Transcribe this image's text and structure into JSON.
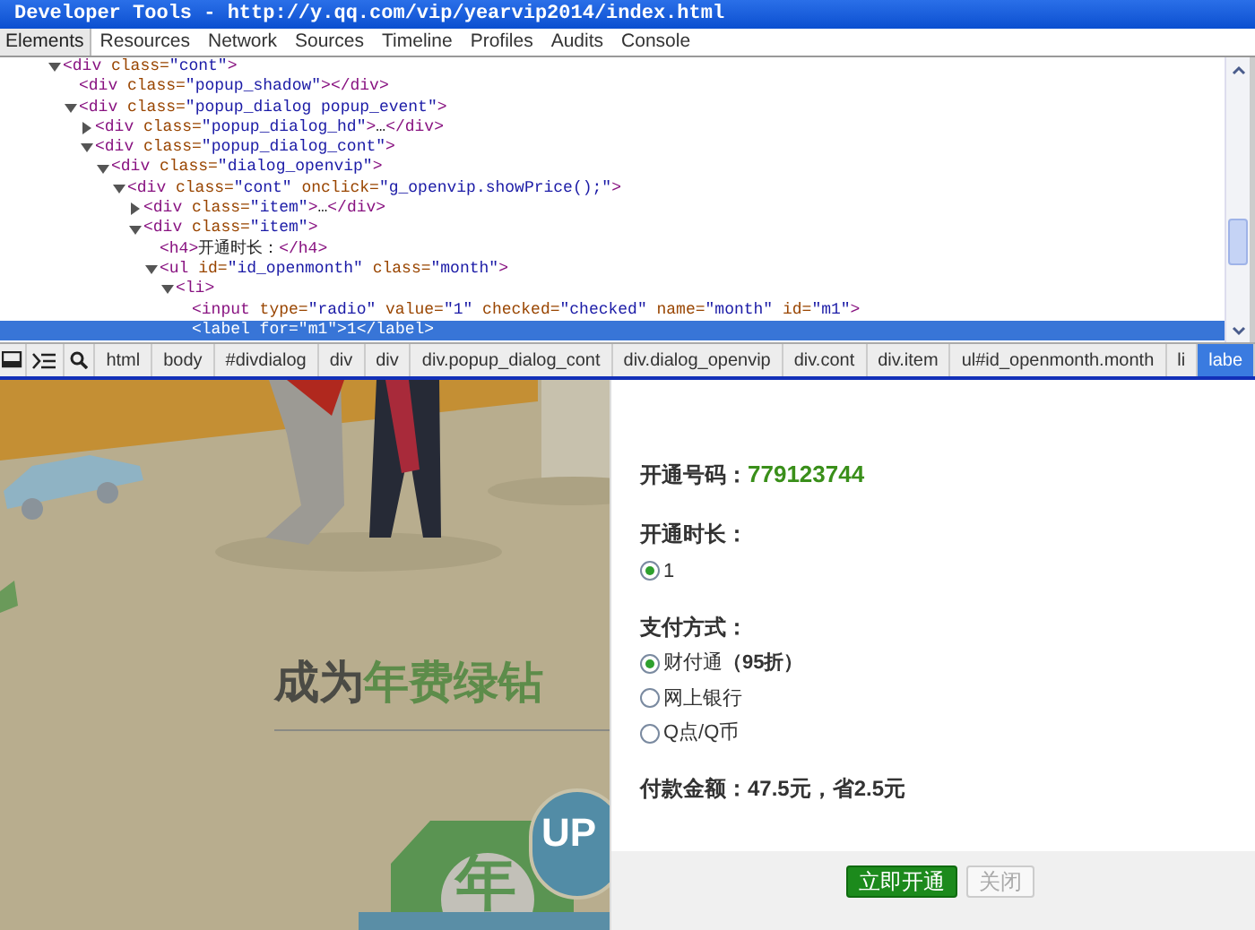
{
  "window": {
    "title": "Developer Tools - http://y.qq.com/vip/yearvip2014/index.html"
  },
  "tabs": [
    {
      "label": "Elements",
      "selected": true
    },
    {
      "label": "Resources",
      "selected": false
    },
    {
      "label": "Network",
      "selected": false
    },
    {
      "label": "Sources",
      "selected": false
    },
    {
      "label": "Timeline",
      "selected": false
    },
    {
      "label": "Profiles",
      "selected": false
    },
    {
      "label": "Audits",
      "selected": false
    },
    {
      "label": "Console",
      "selected": false
    }
  ],
  "dom_tree": [
    {
      "text": "<div class=\"cont\">",
      "expanded": true,
      "selected": false,
      "children": [
        {
          "text": "<div class=\"popup_shadow\"></div>",
          "selected": false
        },
        {
          "text": "<div class=\"popup_dialog popup_event\">",
          "expanded": true,
          "selected": false,
          "children": [
            {
              "text": "<div class=\"popup_dialog_hd\">…</div>",
              "expanded": false,
              "selected": false
            },
            {
              "text": "<div class=\"popup_dialog_cont\">",
              "expanded": true,
              "selected": false,
              "children": [
                {
                  "text": "<div class=\"dialog_openvip\">",
                  "expanded": true,
                  "selected": false,
                  "children": [
                    {
                      "text": "<div class=\"cont\" onclick=\"g_openvip.showPrice();\">",
                      "expanded": true,
                      "selected": false,
                      "children": [
                        {
                          "text": "<div class=\"item\">…</div>",
                          "expanded": false,
                          "selected": false
                        },
                        {
                          "text": "<div class=\"item\">",
                          "expanded": true,
                          "selected": false,
                          "children": [
                            {
                              "text": "<h4>开通时长：</h4>",
                              "selected": false
                            },
                            {
                              "text": "<ul id=\"id_openmonth\" class=\"month\">",
                              "expanded": true,
                              "selected": false,
                              "children": [
                                {
                                  "text": "<li>",
                                  "expanded": true,
                                  "selected": false,
                                  "children": [
                                    {
                                      "text": "<input type=\"radio\" value=\"1\" checked=\"checked\" name=\"month\" id=\"m1\">",
                                      "selected": false
                                    },
                                    {
                                      "text": "<label for=\"m1\">1</label>",
                                      "selected": true
                                    }
                                  ]
                                }
                              ]
                            }
                          ]
                        }
                      ]
                    }
                  ]
                }
              ]
            }
          ]
        }
      ]
    }
  ],
  "breadcrumbs": [
    {
      "label": "html",
      "selected": false
    },
    {
      "label": "body",
      "selected": false
    },
    {
      "label": "#divdialog",
      "selected": false
    },
    {
      "label": "div",
      "selected": false
    },
    {
      "label": "div",
      "selected": false
    },
    {
      "label": "div.popup_dialog_cont",
      "selected": false
    },
    {
      "label": "div.dialog_openvip",
      "selected": false
    },
    {
      "label": "div.cont",
      "selected": false
    },
    {
      "label": "div.item",
      "selected": false
    },
    {
      "label": "ul#id_openmonth.month",
      "selected": false
    },
    {
      "label": "li",
      "selected": false
    },
    {
      "label": "labe",
      "selected": true
    }
  ],
  "page": {
    "heading": {
      "lead": "成为",
      "highlight": "年费绿钻"
    },
    "badge": {
      "top": "UP",
      "main": "年"
    }
  },
  "dialog": {
    "account": {
      "label": "开通号码：",
      "value": "779123744"
    },
    "duration": {
      "label": "开通时长：",
      "options": [
        {
          "label": "1",
          "selected": true
        }
      ]
    },
    "payment": {
      "label": "支付方式：",
      "options": [
        {
          "label": "财付通**（95折）**",
          "selected": true
        },
        {
          "label": "网上银行",
          "selected": false
        },
        {
          "label": "Q点/Q币",
          "selected": false
        }
      ]
    },
    "total": "付款金额：47.5元，省2.5元",
    "buttons": [
      {
        "label": "立即开通",
        "kind": "primary"
      },
      {
        "label": "关闭",
        "kind": "secondary"
      }
    ]
  }
}
